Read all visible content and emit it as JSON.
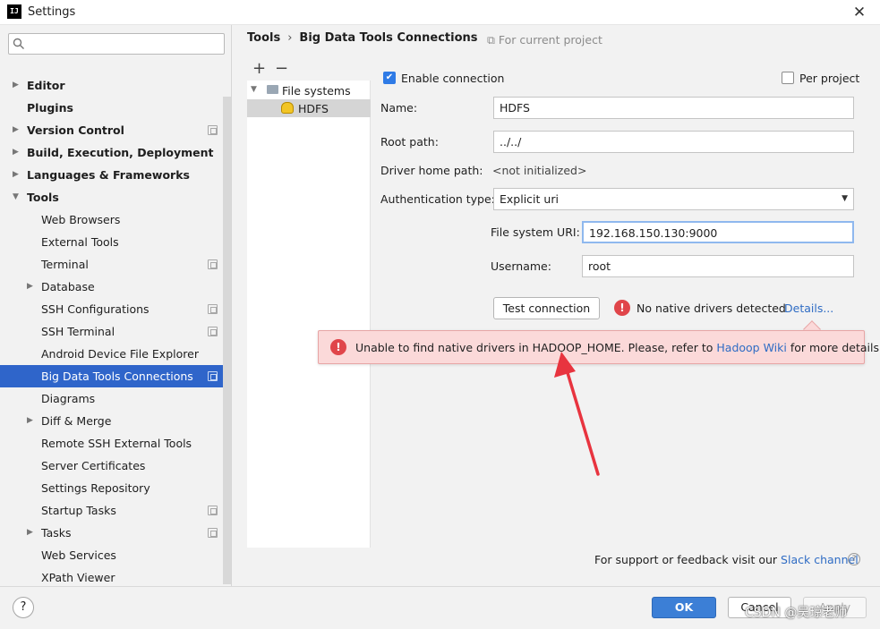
{
  "window": {
    "title": "Settings",
    "app_icon": "IJ",
    "close": "✕"
  },
  "search": {
    "placeholder": ""
  },
  "sidebar": {
    "items": [
      {
        "label": "Editor",
        "bold": true,
        "arrow": "▶",
        "level": 0
      },
      {
        "label": "Plugins",
        "bold": true,
        "arrow": "",
        "level": 0
      },
      {
        "label": "Version Control",
        "bold": true,
        "arrow": "▶",
        "level": 0,
        "project": true
      },
      {
        "label": "Build, Execution, Deployment",
        "bold": true,
        "arrow": "▶",
        "level": 0
      },
      {
        "label": "Languages & Frameworks",
        "bold": true,
        "arrow": "▶",
        "level": 0
      },
      {
        "label": "Tools",
        "bold": true,
        "arrow": "▼",
        "level": 0
      },
      {
        "label": "Web Browsers",
        "bold": false,
        "arrow": "",
        "level": 1
      },
      {
        "label": "External Tools",
        "bold": false,
        "arrow": "",
        "level": 1
      },
      {
        "label": "Terminal",
        "bold": false,
        "arrow": "",
        "level": 1,
        "project": true
      },
      {
        "label": "Database",
        "bold": false,
        "arrow": "▶",
        "level": 1
      },
      {
        "label": "SSH Configurations",
        "bold": false,
        "arrow": "",
        "level": 1,
        "project": true
      },
      {
        "label": "SSH Terminal",
        "bold": false,
        "arrow": "",
        "level": 1,
        "project": true
      },
      {
        "label": "Android Device File Explorer",
        "bold": false,
        "arrow": "",
        "level": 1
      },
      {
        "label": "Big Data Tools Connections",
        "bold": false,
        "arrow": "",
        "level": 1,
        "project": true,
        "selected": true
      },
      {
        "label": "Diagrams",
        "bold": false,
        "arrow": "",
        "level": 1
      },
      {
        "label": "Diff & Merge",
        "bold": false,
        "arrow": "▶",
        "level": 1
      },
      {
        "label": "Remote SSH External Tools",
        "bold": false,
        "arrow": "",
        "level": 1
      },
      {
        "label": "Server Certificates",
        "bold": false,
        "arrow": "",
        "level": 1
      },
      {
        "label": "Settings Repository",
        "bold": false,
        "arrow": "",
        "level": 1
      },
      {
        "label": "Startup Tasks",
        "bold": false,
        "arrow": "",
        "level": 1,
        "project": true
      },
      {
        "label": "Tasks",
        "bold": false,
        "arrow": "▶",
        "level": 1,
        "project": true
      },
      {
        "label": "Web Services",
        "bold": false,
        "arrow": "",
        "level": 1
      },
      {
        "label": "XPath Viewer",
        "bold": false,
        "arrow": "",
        "level": 1
      }
    ]
  },
  "header": {
    "crumb_root": "Tools",
    "crumb_sep": "›",
    "crumb_current": "Big Data Tools Connections",
    "for_project": "⧉ For current project"
  },
  "connections": {
    "add": "+",
    "remove": "−",
    "group_arrow": "▼",
    "group_label": "File systems",
    "item_label": "HDFS"
  },
  "form": {
    "enable_label": "Enable connection",
    "enable_checked": "✔",
    "per_project_label": "Per project",
    "name_label": "Name:",
    "name_value": "HDFS",
    "root_label": "Root path:",
    "root_value": "../../",
    "driver_label": "Driver home path:",
    "driver_value": "<not initialized>",
    "auth_label": "Authentication type:",
    "auth_value": "Explicit uri",
    "auth_arrow": "▼",
    "uri_label": "File system URI:",
    "uri_value": "192.168.150.130:9000",
    "user_label": "Username:",
    "user_value": "root",
    "test_button": "Test connection",
    "error_mark": "!",
    "no_drivers": "No native drivers detected",
    "details": "Details..."
  },
  "balloon": {
    "text_before": "Unable to find native drivers in HADOOP_HOME. Please, refer to ",
    "link": "Hadoop Wiki",
    "text_after": " for more details."
  },
  "support": {
    "text": "For support or feedback visit our ",
    "link": "Slack channel",
    "help": "?"
  },
  "buttons": {
    "help": "?",
    "ok": "OK",
    "cancel": "Cancel",
    "apply": "Apply"
  },
  "watermark": "CSDN @吴琼老师",
  "colors": {
    "selection": "#2f65ca",
    "link": "#2f6cc4",
    "error": "#e0454a",
    "balloon": "#fbd9d9",
    "arrow": "#e8343f"
  }
}
